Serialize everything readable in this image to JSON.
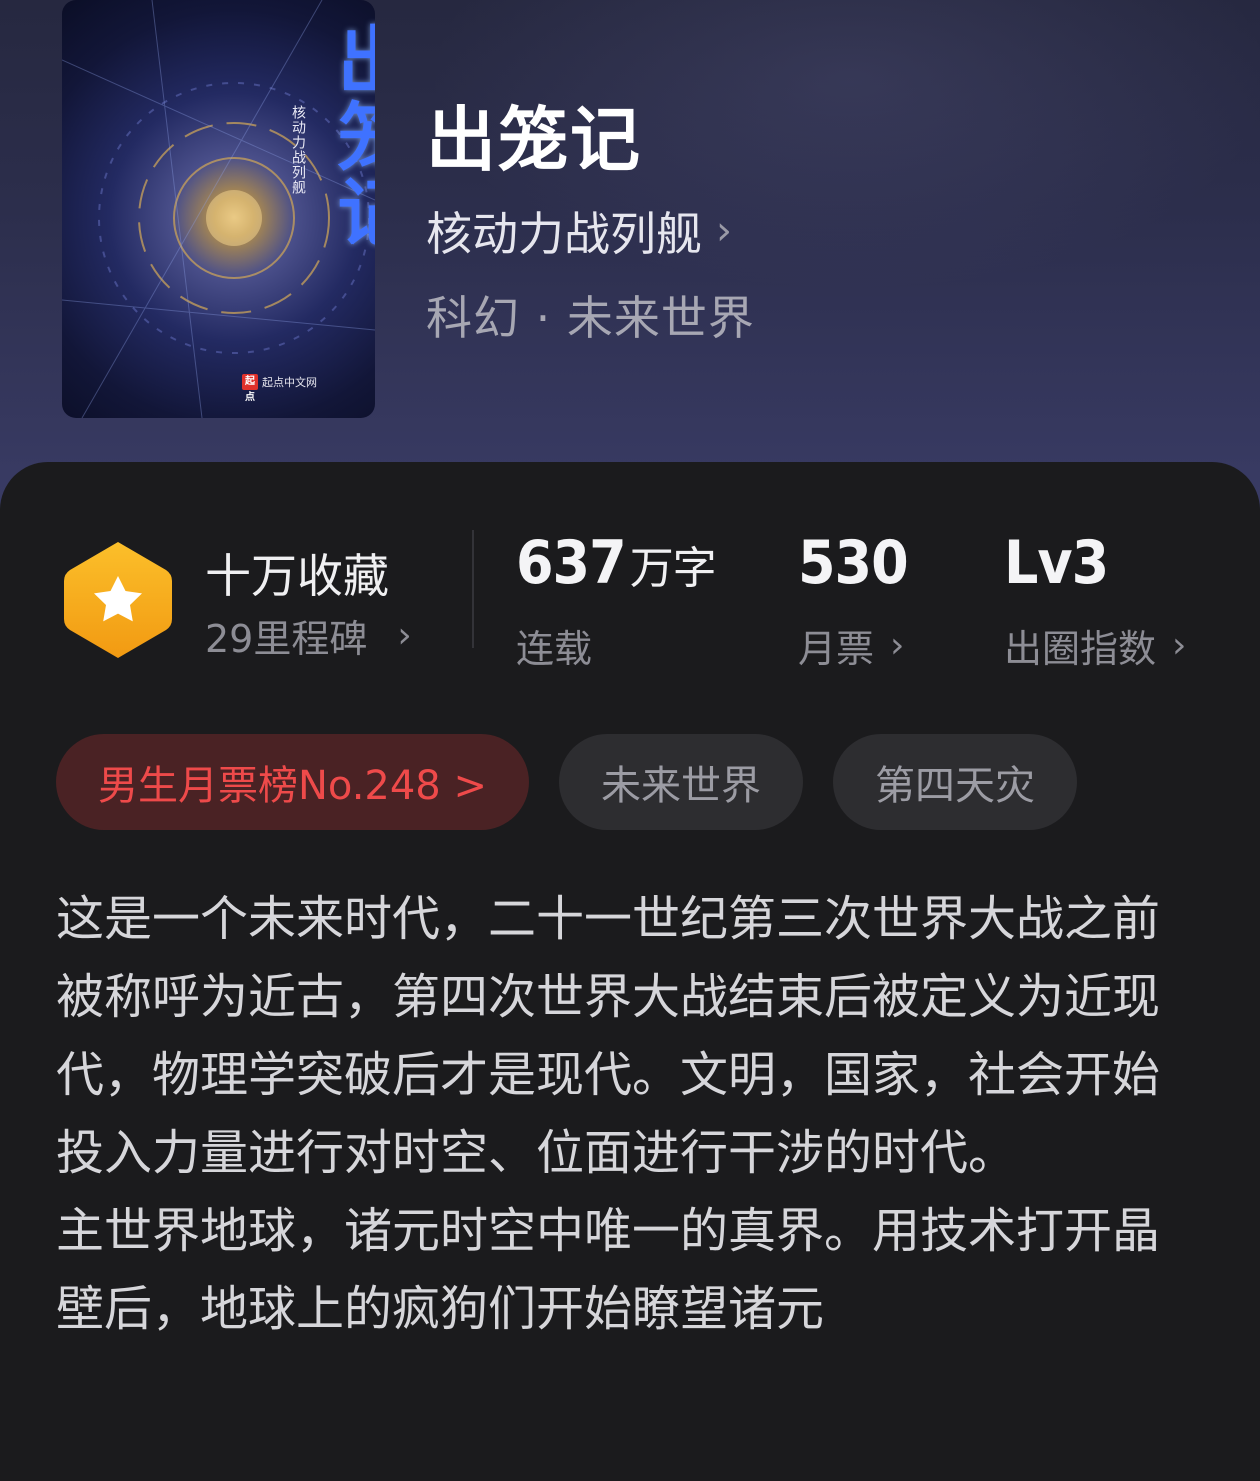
{
  "book": {
    "title": "出笼记",
    "author": "核动力战列舰",
    "genre": "科幻 · 未来世界",
    "cover": {
      "title_text": "出笼记",
      "author_text": "核动力战列舰",
      "publisher_mark": "起点",
      "publisher": "起点中文网"
    }
  },
  "stats": {
    "collection_level": "十万收藏",
    "milestone": "29里程碑",
    "word_count": "637",
    "word_unit": "万字",
    "status": "连载",
    "monthly_votes": "530",
    "monthly_votes_label": "月票",
    "breakout_level": "Lv3",
    "breakout_label": "出圈指数"
  },
  "tags": [
    {
      "label": "男生月票榜No.248 >"
    },
    {
      "label": "未来世界"
    },
    {
      "label": "第四天灾"
    }
  ],
  "description": [
    "这是一个未来时代，二十一世纪第三次世界大战之前被称呼为近古，第四次世界大战结束后被定义为近现代，物理学突破后才是现代。文明，国家，社会开始投入力量进行对时空、位面进行干涉的时代。",
    "主世界地球，诸元时空中唯一的真界。用技术打开晶壁后，地球上的疯狗们开始瞭望诸元"
  ],
  "icons": {
    "badge": "star-hexagon-icon",
    "chevron": "chevron-right-icon"
  },
  "colors": {
    "badge_gold": "#f7a61c",
    "rank_red": "#ee4a4a",
    "card_bg": "#1b1b1d"
  }
}
